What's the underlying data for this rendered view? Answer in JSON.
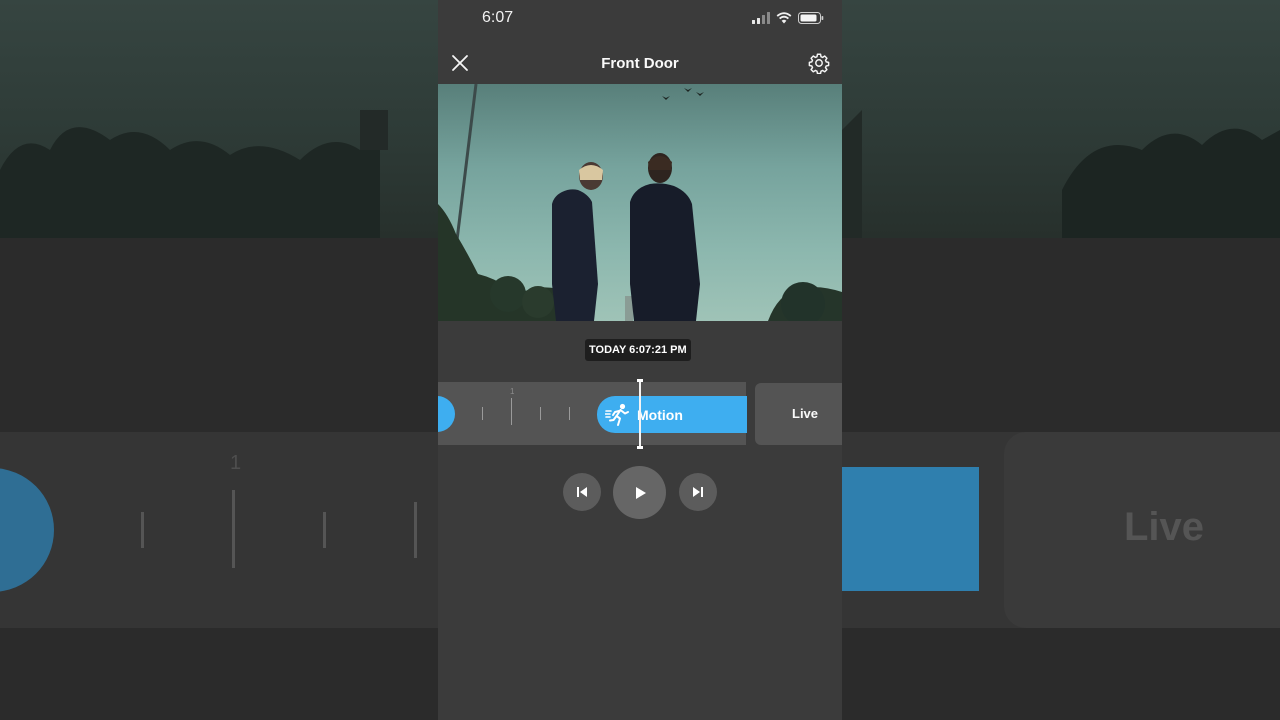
{
  "status_bar": {
    "time": "6:07",
    "icons": [
      "signal-icon",
      "wifi-icon",
      "battery-icon"
    ]
  },
  "nav": {
    "title": "Front Door",
    "close_icon": "close-icon",
    "settings_icon": "gear-icon"
  },
  "player": {
    "timestamp": "TODAY 6:07:21 PM"
  },
  "timeline": {
    "tick_label": "1",
    "event_label": "Motion",
    "event_icon": "running-person-icon",
    "live_label": "Live"
  },
  "controls": {
    "prev_icon": "skip-previous-icon",
    "play_icon": "play-icon",
    "next_icon": "skip-next-icon"
  },
  "background": {
    "tick_label": "1",
    "live_label": "Live"
  },
  "colors": {
    "accent": "#3eaef0",
    "panel": "#3b3b3b",
    "timeline": "#545454"
  }
}
